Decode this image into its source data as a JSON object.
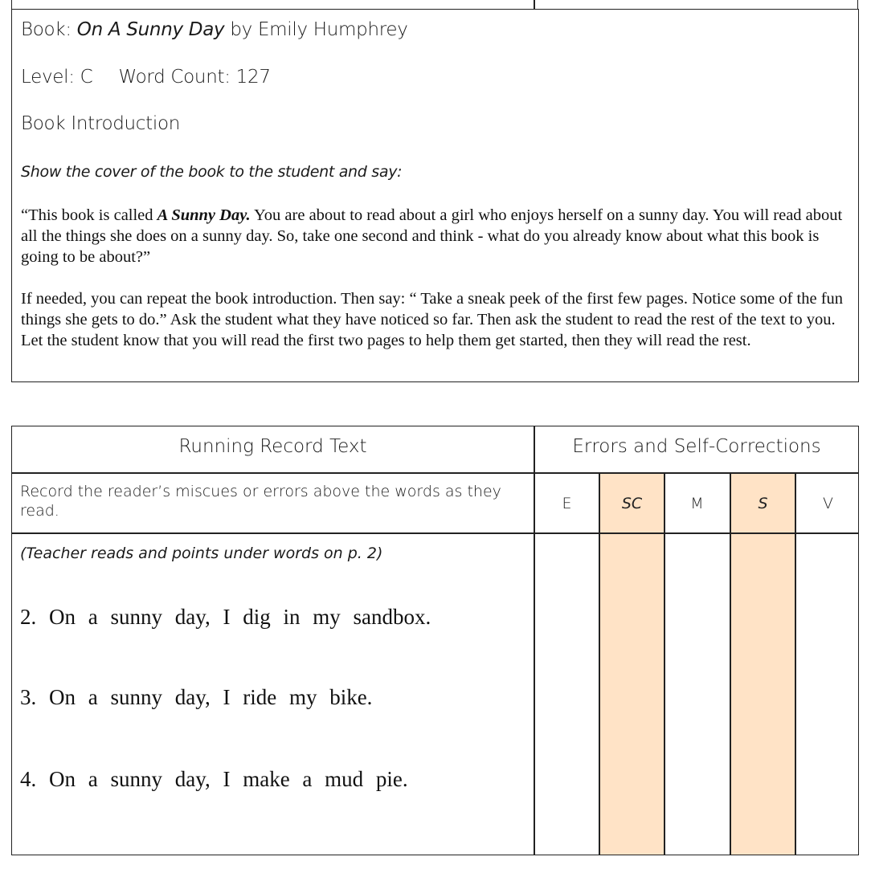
{
  "book": {
    "label": "Book:",
    "title": "On A Sunny Day",
    "by": "by Emily Humphrey"
  },
  "level": {
    "label": "Level: C",
    "word_count": "Word Count: 127"
  },
  "intro": {
    "heading": "Book Introduction",
    "instruction": "Show the cover of the book to the student and say:",
    "para1_a": "“This book is called ",
    "para1_title": "A Sunny Day.",
    "para1_b": " You are about to read about a girl who enjoys herself on a sunny day. You will read about all the things she does on a sunny day. So, take one second and think - what do you already know about what this book is going to be about?”",
    "para2": "If needed, you can repeat the book introduction. Then say: “ Take a sneak peek of the first few pages. Notice some of the fun things she gets to do.” Ask the student what they have noticed so far. Then ask the student to read the rest of the text to you. Let the student know that you will read the first two pages to help them get started, then they will read the rest."
  },
  "table": {
    "header_text": "Running Record Text",
    "header_errors": "Errors and Self-Corrections",
    "instructions": "Record the reader’s miscues or errors above the words as they read.",
    "columns": [
      "E",
      "SC",
      "M",
      "S",
      "V"
    ],
    "teacher_note": "(Teacher reads and points under words on p. 2)",
    "sentences": [
      "2. On a sunny day, I dig in my sandbox.",
      "3. On a sunny day, I ride my bike.",
      "4. On a sunny day, I make a mud pie."
    ],
    "highlight_color": "#FFE3C6"
  }
}
